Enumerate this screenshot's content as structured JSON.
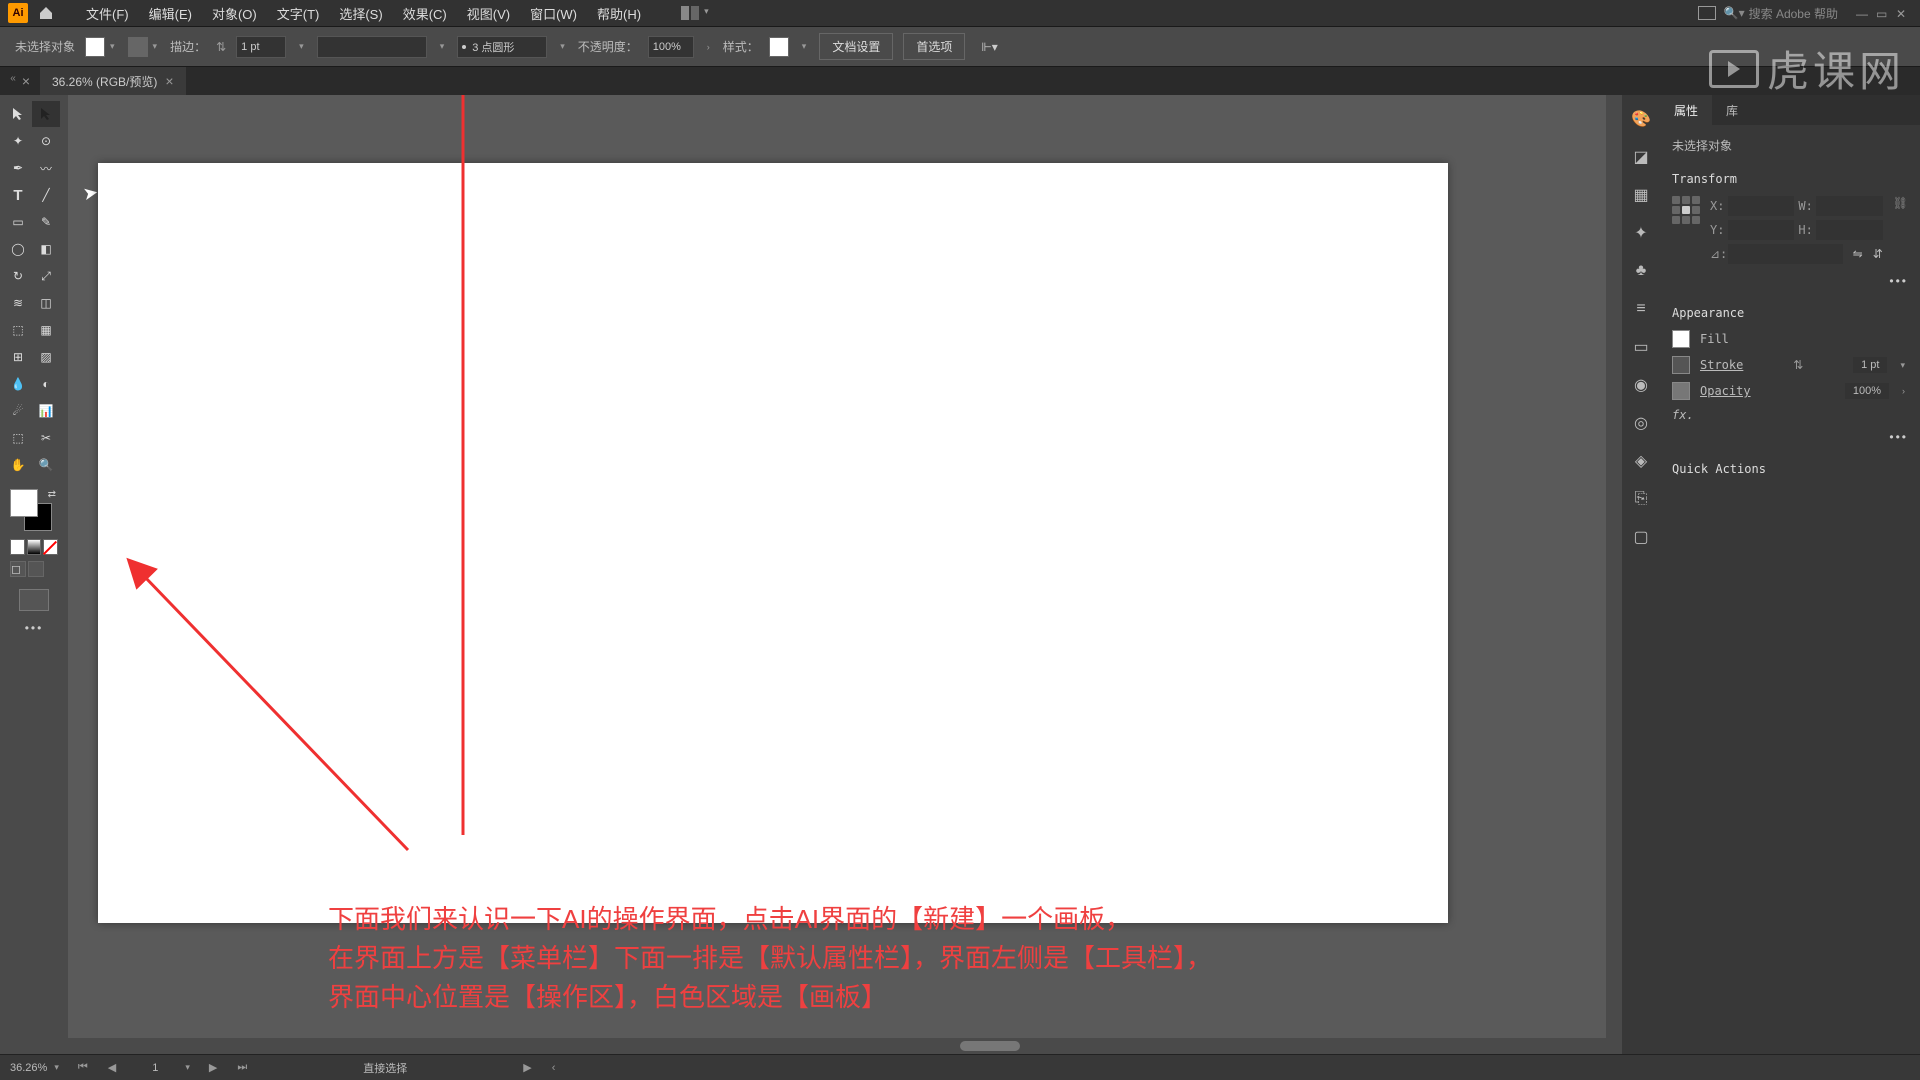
{
  "menu": {
    "file": "文件(F)",
    "edit": "编辑(E)",
    "object": "对象(O)",
    "type": "文字(T)",
    "select": "选择(S)",
    "effect": "效果(C)",
    "view": "视图(V)",
    "window": "窗口(W)",
    "help": "帮助(H)"
  },
  "search_placeholder": "搜索 Adobe 帮助",
  "control": {
    "no_sel": "未选择对象",
    "stroke_label": "描边：",
    "stroke_val": "1 pt",
    "dash_label": "3 点圆形",
    "opacity_label": "不透明度：",
    "opacity_val": "100%",
    "style_label": "样式：",
    "doc_setup": "文档设置",
    "prefs": "首选项"
  },
  "doc_tab": {
    "title": "36.26% (RGB/预览)"
  },
  "annotation": {
    "line1": "下面我们来认识一下AI的操作界面，点击AI界面的【新建】一个画板，",
    "line2": "在界面上方是【菜单栏】下面一排是【默认属性栏】，界面左侧是【工具栏】，",
    "line3": "界面中心位置是【操作区】，白色区域是【画板】"
  },
  "props": {
    "tab_props": "属性",
    "tab_lib": "库",
    "no_sel": "未选择对象",
    "transform": "Transform",
    "x": "X:",
    "y": "Y:",
    "w": "W:",
    "h": "H:",
    "angle": "⊿:",
    "appearance": "Appearance",
    "fill": "Fill",
    "stroke": "Stroke",
    "stroke_val": "1 pt",
    "opacity": "Opacity",
    "opacity_val": "100%",
    "fx": "fx.",
    "quick": "Quick Actions"
  },
  "status": {
    "zoom": "36.26%",
    "page": "1",
    "tool": "直接选择"
  },
  "watermark": "虎课网"
}
